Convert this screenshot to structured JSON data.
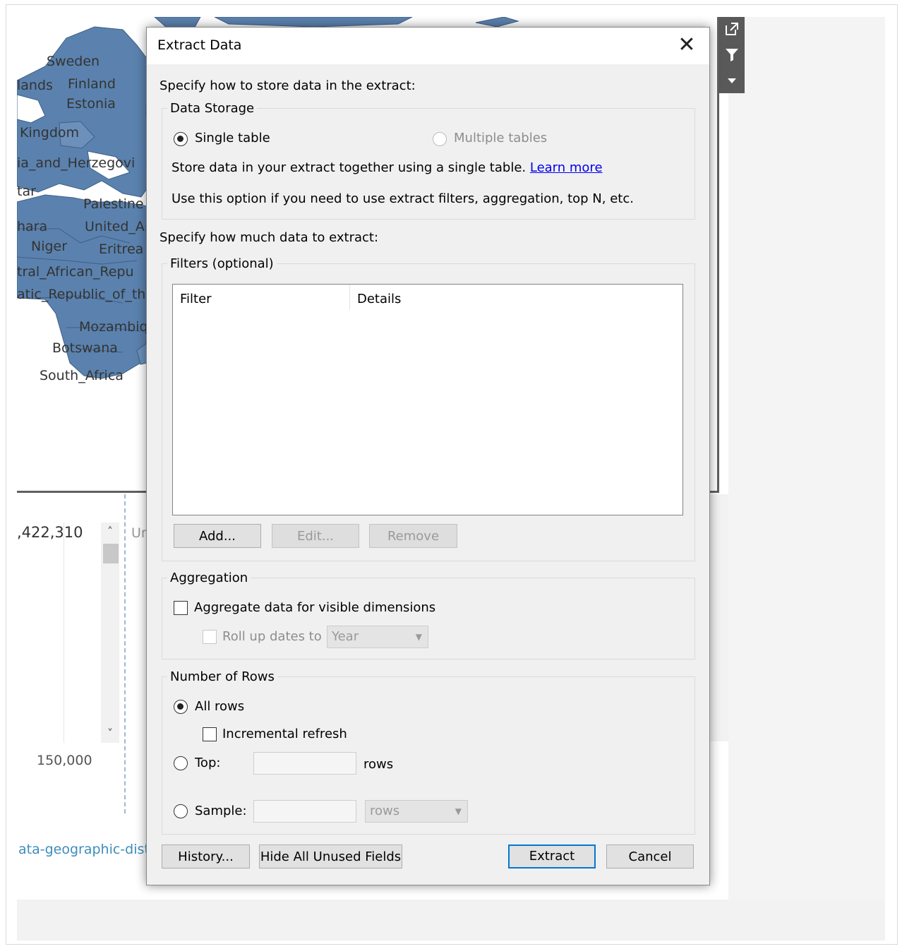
{
  "background": {
    "map_labels": [
      "Sweden",
      "lands",
      "Finland",
      "Estonia",
      "Kingdom",
      "ia_and_Herzegovi",
      "tar",
      "Palestine",
      "hara",
      "United_A",
      "Niger",
      "Eritrea",
      "tral_African_Repu",
      "atic_Republic_of_th",
      "Mozambiq",
      "Botswana",
      "South_Africa"
    ],
    "big_number": ",422,310",
    "axis_number": "150,000",
    "link_text": "ata-geographic-dist",
    "partial_text": "Ur",
    "map_fill_color": "#5b82ae"
  },
  "toolbar": {
    "icons": [
      "external-link-icon",
      "filter-icon",
      "dropdown-arrow-icon"
    ]
  },
  "dialog": {
    "title": "Extract Data",
    "close_label": "✕",
    "storage_prompt": "Specify how to store data in the extract:",
    "data_storage": {
      "title": "Data Storage",
      "single_table": "Single table",
      "multiple_tables": "Multiple tables",
      "selected": "Single table",
      "description": "Store data in your extract together using a single table.",
      "learn_more": "Learn more",
      "note": "Use this option if you need to use extract filters, aggregation, top N, etc."
    },
    "amount_prompt": "Specify how much data to extract:",
    "filters": {
      "title": "Filters (optional)",
      "columns": [
        "Filter",
        "Details"
      ],
      "rows": [],
      "add": "Add...",
      "edit": "Edit...",
      "remove": "Remove"
    },
    "aggregation": {
      "title": "Aggregation",
      "aggregate_label": "Aggregate data for visible dimensions",
      "aggregate_checked": false,
      "rollup_label": "Roll up dates to",
      "rollup_value": "Year"
    },
    "rows": {
      "title": "Number of Rows",
      "all_rows": "All rows",
      "incremental": "Incremental refresh",
      "top": "Top:",
      "top_value": "",
      "top_suffix": "rows",
      "sample": "Sample:",
      "sample_value": "",
      "sample_unit": "rows",
      "selected": "All rows"
    },
    "buttons": {
      "history": "History...",
      "hide_unused": "Hide All Unused Fields",
      "extract": "Extract",
      "cancel": "Cancel"
    }
  }
}
